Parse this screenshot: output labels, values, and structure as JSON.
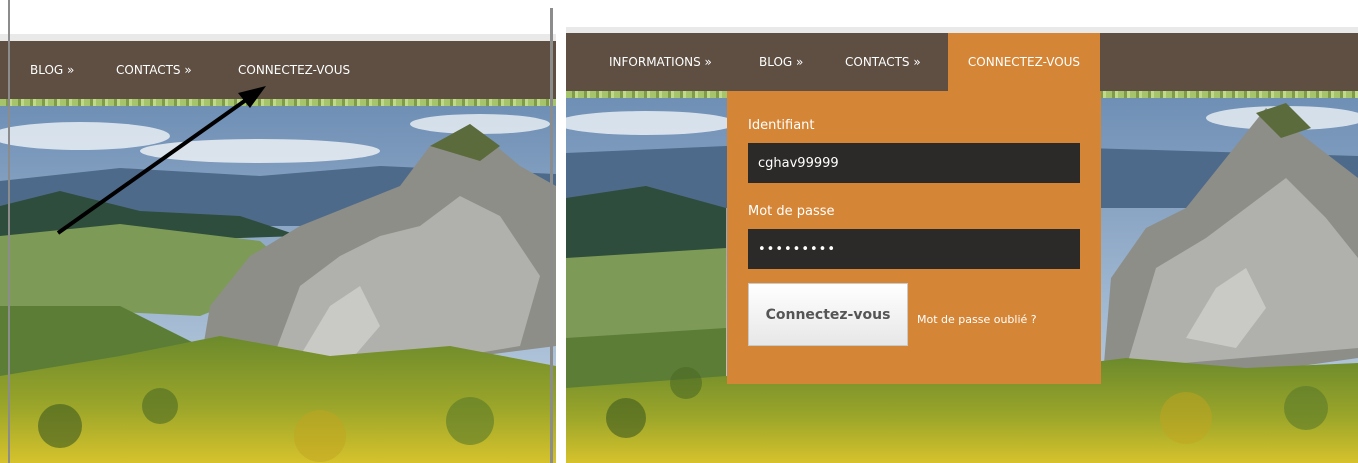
{
  "left": {
    "nav": {
      "items": [
        {
          "label": "BLOG »"
        },
        {
          "label": "CONTACTS »"
        },
        {
          "label": "CONNECTEZ-VOUS"
        }
      ]
    }
  },
  "right": {
    "nav": {
      "items": [
        {
          "label": "INFORMATIONS »"
        },
        {
          "label": "BLOG »"
        },
        {
          "label": "CONTACTS »"
        },
        {
          "label": "CONNECTEZ-VOUS"
        }
      ]
    },
    "login": {
      "username_label": "Identifiant",
      "username_value": "cghav99999",
      "password_label": "Mot de passe",
      "password_value": "•••••••••",
      "submit_label": "Connectez-vous",
      "forgot_label": "Mot de passe oublié ?"
    }
  },
  "colors": {
    "nav_bg": "#5e4f42",
    "active_tab": "#d58536",
    "input_bg": "#2c2a28"
  },
  "icons": {
    "annotation": "arrow-annotation"
  }
}
